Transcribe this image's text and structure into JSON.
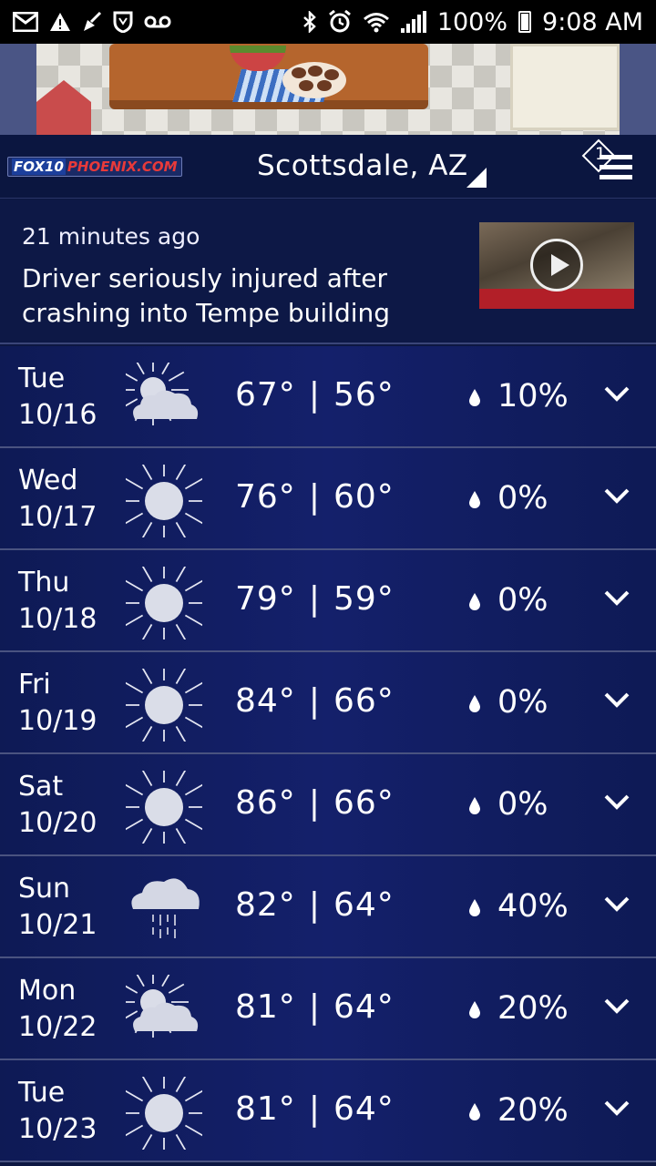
{
  "status_bar": {
    "left_icons": [
      "mail-icon",
      "warning-icon",
      "broom-icon",
      "shield-icon",
      "voicemail-icon"
    ],
    "right_icons": [
      "bluetooth-icon",
      "alarm-icon",
      "wifi-icon",
      "signal-icon",
      "battery-icon"
    ],
    "battery": "100%",
    "time": "9:08 AM"
  },
  "header": {
    "logo_fox": "FOX10",
    "logo_phoenix": "PHOENIX.COM",
    "location": "Scottsdale, AZ",
    "notification_count": "1"
  },
  "news": {
    "time_ago": "21 minutes ago",
    "headline": "Driver seriously injured after crashing into Tempe building"
  },
  "forecast": [
    {
      "day": "Tue",
      "date": "10/16",
      "icon": "partly-cloudy",
      "high": "67°",
      "low": "56°",
      "precip": "10%"
    },
    {
      "day": "Wed",
      "date": "10/17",
      "icon": "sunny",
      "high": "76°",
      "low": "60°",
      "precip": "0%"
    },
    {
      "day": "Thu",
      "date": "10/18",
      "icon": "sunny",
      "high": "79°",
      "low": "59°",
      "precip": "0%"
    },
    {
      "day": "Fri",
      "date": "10/19",
      "icon": "sunny",
      "high": "84°",
      "low": "66°",
      "precip": "0%"
    },
    {
      "day": "Sat",
      "date": "10/20",
      "icon": "sunny",
      "high": "86°",
      "low": "66°",
      "precip": "0%"
    },
    {
      "day": "Sun",
      "date": "10/21",
      "icon": "rain",
      "high": "82°",
      "low": "64°",
      "precip": "40%"
    },
    {
      "day": "Mon",
      "date": "10/22",
      "icon": "partly-cloudy",
      "high": "81°",
      "low": "64°",
      "precip": "20%"
    },
    {
      "day": "Tue",
      "date": "10/23",
      "icon": "sunny",
      "high": "81°",
      "low": "64°",
      "precip": "20%"
    }
  ],
  "separator": "|"
}
